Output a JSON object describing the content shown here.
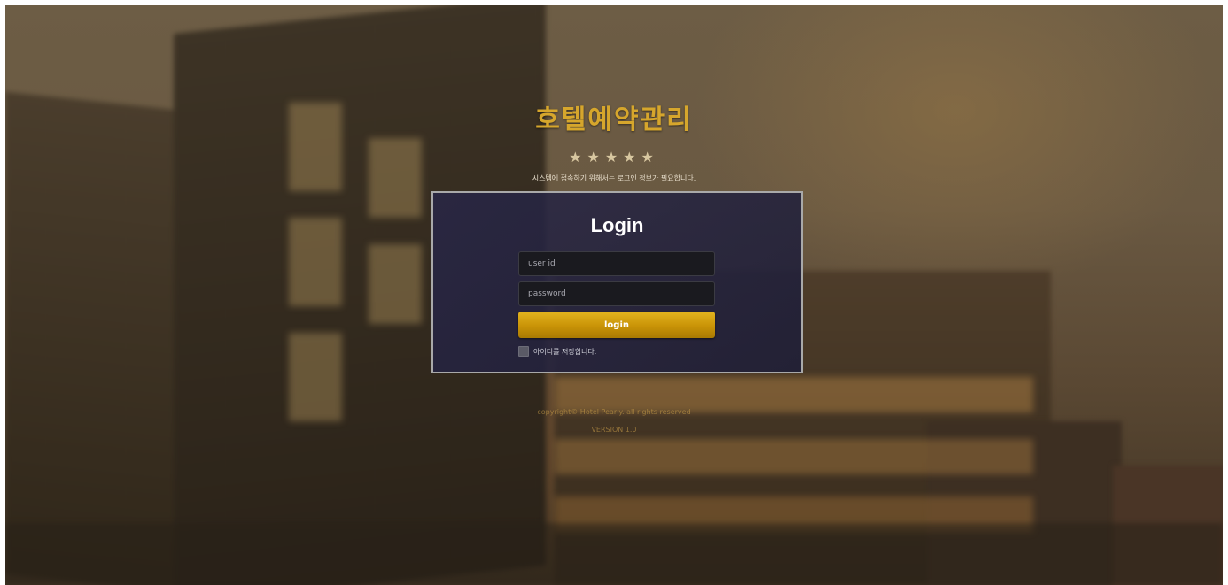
{
  "header": {
    "app_title": "호텔예약관리",
    "rating_stars": "★★★★★",
    "notice": "시스템에 접속하기 위해서는 로그인 정보가 필요합니다."
  },
  "login": {
    "heading": "Login",
    "user_id_placeholder": "user id",
    "password_placeholder": "password",
    "submit_label": "login",
    "remember_label": "아이디를 저장합니다."
  },
  "footer": {
    "copyright": "copyright© Hotel Pearly. all rights reserved",
    "version": "VERSION 1.0"
  },
  "colors": {
    "accent_gold": "#d6a62c",
    "button_gold": "#c99307",
    "panel_bg": "#28263f"
  }
}
